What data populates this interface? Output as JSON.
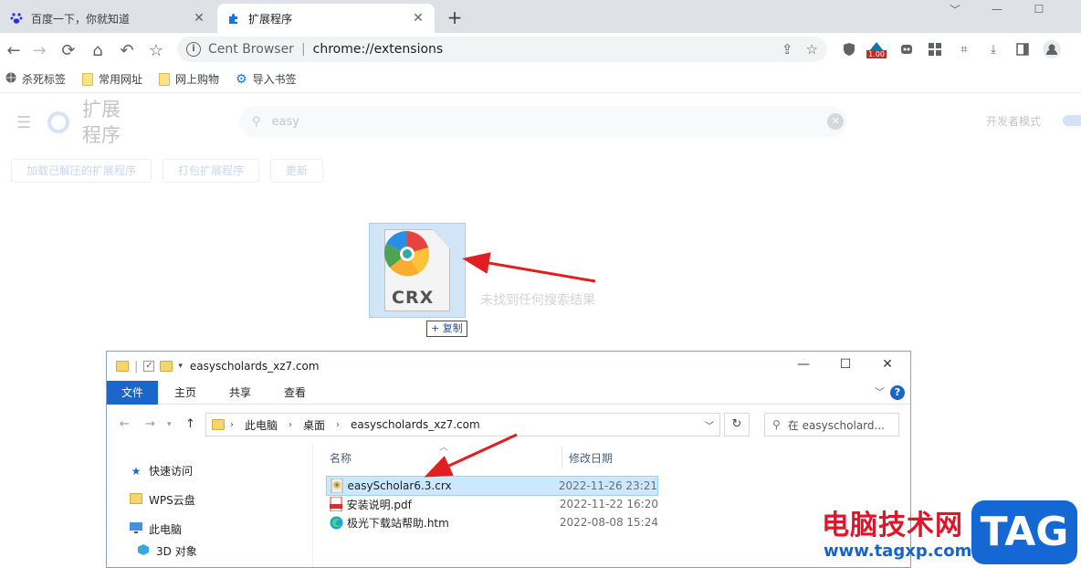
{
  "browser": {
    "tabs": [
      {
        "title": "百度一下，你就知道",
        "icon": "paw-icon"
      },
      {
        "title": "扩展程序",
        "icon": "puzzle-icon"
      }
    ],
    "omnibox": {
      "site_label": "Cent Browser",
      "separator": "|",
      "url": "chrome://extensions"
    },
    "extension_badge": "1.00",
    "bookmarks": [
      {
        "label": "杀死标签",
        "icon": "globe-icon"
      },
      {
        "label": "常用网址",
        "icon": "folder-icon"
      },
      {
        "label": "网上购物",
        "icon": "folder-icon"
      },
      {
        "label": "导入书签",
        "icon": "gear-icon"
      }
    ]
  },
  "extensions_page": {
    "title": "扩展程序",
    "search_query": "easy",
    "developer_mode_label": "开发者模式",
    "actions": {
      "load_unpacked": "加载已解压的扩展程序",
      "pack": "打包扩展程序",
      "update": "更新"
    },
    "no_results": "未找到任何搜索结果"
  },
  "drag": {
    "icon_label": "CRX",
    "copy_tooltip": "+ 复制"
  },
  "explorer": {
    "title": "easyscholards_xz7.com",
    "ribbon_tabs": [
      "文件",
      "主页",
      "共享",
      "查看"
    ],
    "breadcrumb": [
      "此电脑",
      "桌面",
      "easyscholards_xz7.com"
    ],
    "search_placeholder": "在 easyscholard...",
    "nav": [
      "快速访问",
      "WPS云盘",
      "此电脑",
      "3D 对象"
    ],
    "columns": {
      "name": "名称",
      "modified": "修改日期"
    },
    "files": [
      {
        "name": "easyScholar6.3.crx",
        "date": "2022-11-26 23:21",
        "icon": "crx-file-icon",
        "selected": true
      },
      {
        "name": "安装说明.pdf",
        "date": "2022-11-22 16:20",
        "icon": "pdf-file-icon",
        "selected": false
      },
      {
        "name": "极光下载站帮助.htm",
        "date": "2022-08-08 15:24",
        "icon": "edge-file-icon",
        "selected": false
      }
    ]
  },
  "watermark": {
    "site_cn": "电脑技术网",
    "site_url": "www.tagxp.com",
    "tag": "TAG"
  },
  "colors": {
    "accent": "#1b66c9",
    "arrow": "#e02020",
    "selection": "#cce8ff"
  }
}
